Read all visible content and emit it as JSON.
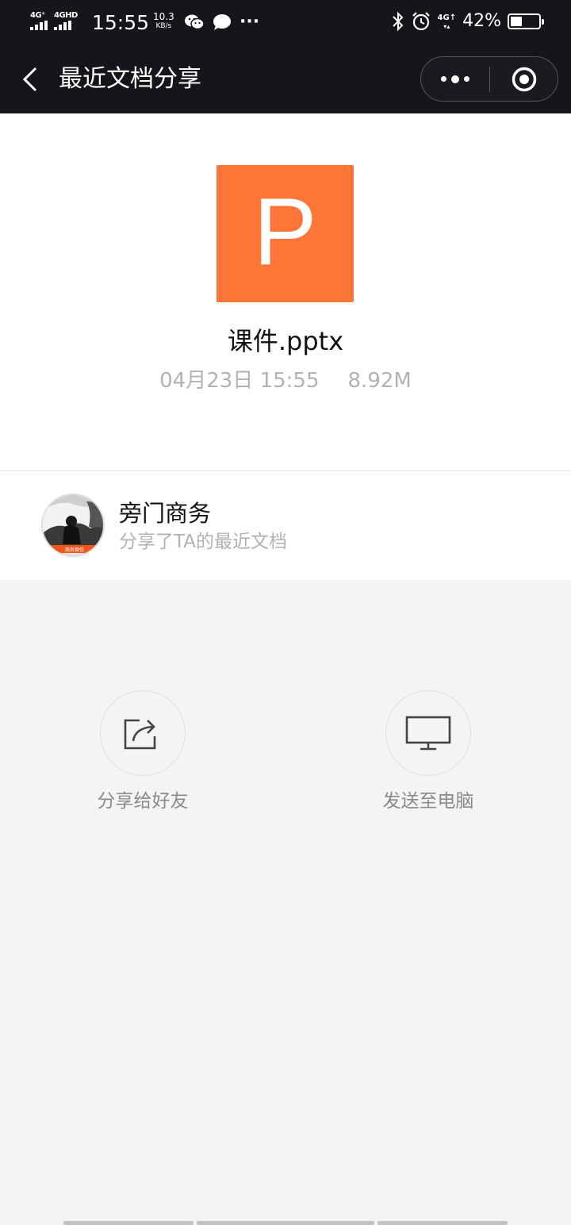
{
  "status_bar": {
    "net1": "4G⁺",
    "net2": "4GᴴᴰHD",
    "net2_clean": "4GHD",
    "time": "15:55",
    "speed_value": "10.3",
    "speed_unit": "KB/s",
    "dots": "···",
    "right_net_top": "4G↑",
    "right_net_bottom": "▾▴",
    "battery_pct": "42%",
    "battery_level": 0.42,
    "icons": [
      "wechat-icon",
      "message-bubble-icon",
      "bluetooth-icon",
      "alarm-icon"
    ]
  },
  "nav": {
    "title": "最近文档分享"
  },
  "file": {
    "icon_letter": "P",
    "icon_color": "#fe7637",
    "name": "课件.pptx",
    "date": "04月23日 15:55",
    "size": "8.92M"
  },
  "sharer": {
    "name": "旁门商务",
    "subtitle": "分享了TA的最近文档",
    "avatar_badge": "商务微信"
  },
  "actions": {
    "share_label": "分享给好友",
    "pc_label": "发送至电脑"
  }
}
